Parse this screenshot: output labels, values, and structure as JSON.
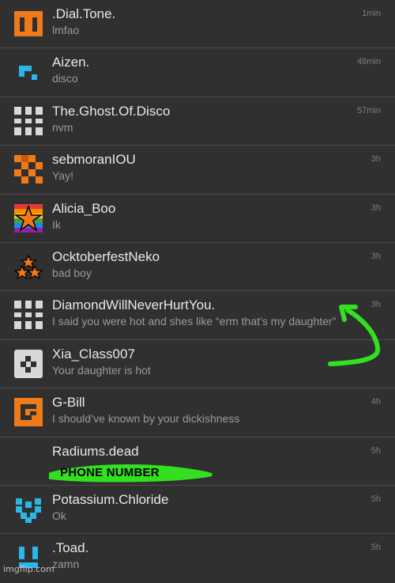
{
  "conversations": [
    {
      "name": ".Dial.Tone.",
      "message": "lmfao",
      "time": "1min",
      "icon": "orange-block-icon"
    },
    {
      "name": "Aizen.",
      "message": "disco",
      "time": "48min",
      "icon": "blue-corner-icon"
    },
    {
      "name": "The.Ghost.Of.Disco",
      "message": "nvm",
      "time": "57min",
      "icon": "white-cross-icon"
    },
    {
      "name": "sebmoranIOU",
      "message": "Yay!",
      "time": "3h",
      "icon": "orange-pixel-icon"
    },
    {
      "name": "Alicia_Boo",
      "message": "Ik",
      "time": "3h",
      "icon": "rainbow-star-icon"
    },
    {
      "name": "OcktoberfestNeko",
      "message": "bad boy",
      "time": "3h",
      "icon": "three-stars-icon"
    },
    {
      "name": "DiamondWillNeverHurtYou.",
      "message": "I said you were hot and shes like “erm that’s my daughter”",
      "time": "3h",
      "icon": "white-cross-icon"
    },
    {
      "name": "Xia_Class007",
      "message": "Your daughter is hot",
      "time": "",
      "icon": "gray-checker-icon"
    },
    {
      "name": "G-Bill",
      "message": "I should’ve known by your dickishness",
      "time": "4h",
      "icon": "orange-g-icon"
    },
    {
      "name": "Radiums.dead",
      "message": "",
      "time": "5h",
      "icon": ""
    },
    {
      "name": "Potassium.Chloride",
      "message": "Ok",
      "time": "5h",
      "icon": "blue-heart-icon"
    },
    {
      "name": ".Toad.",
      "message": "zamn",
      "time": "5h",
      "icon": "blue-bars-icon"
    }
  ],
  "annotations": {
    "redaction_label": "PHONE NUMBER",
    "scribble_color": "#33e020",
    "arrow_color": "#33e020"
  },
  "watermark": "imgflip.com",
  "colors": {
    "orange": "#f07a1a",
    "blue": "#2bb6e8",
    "background": "#2e2e2e"
  }
}
